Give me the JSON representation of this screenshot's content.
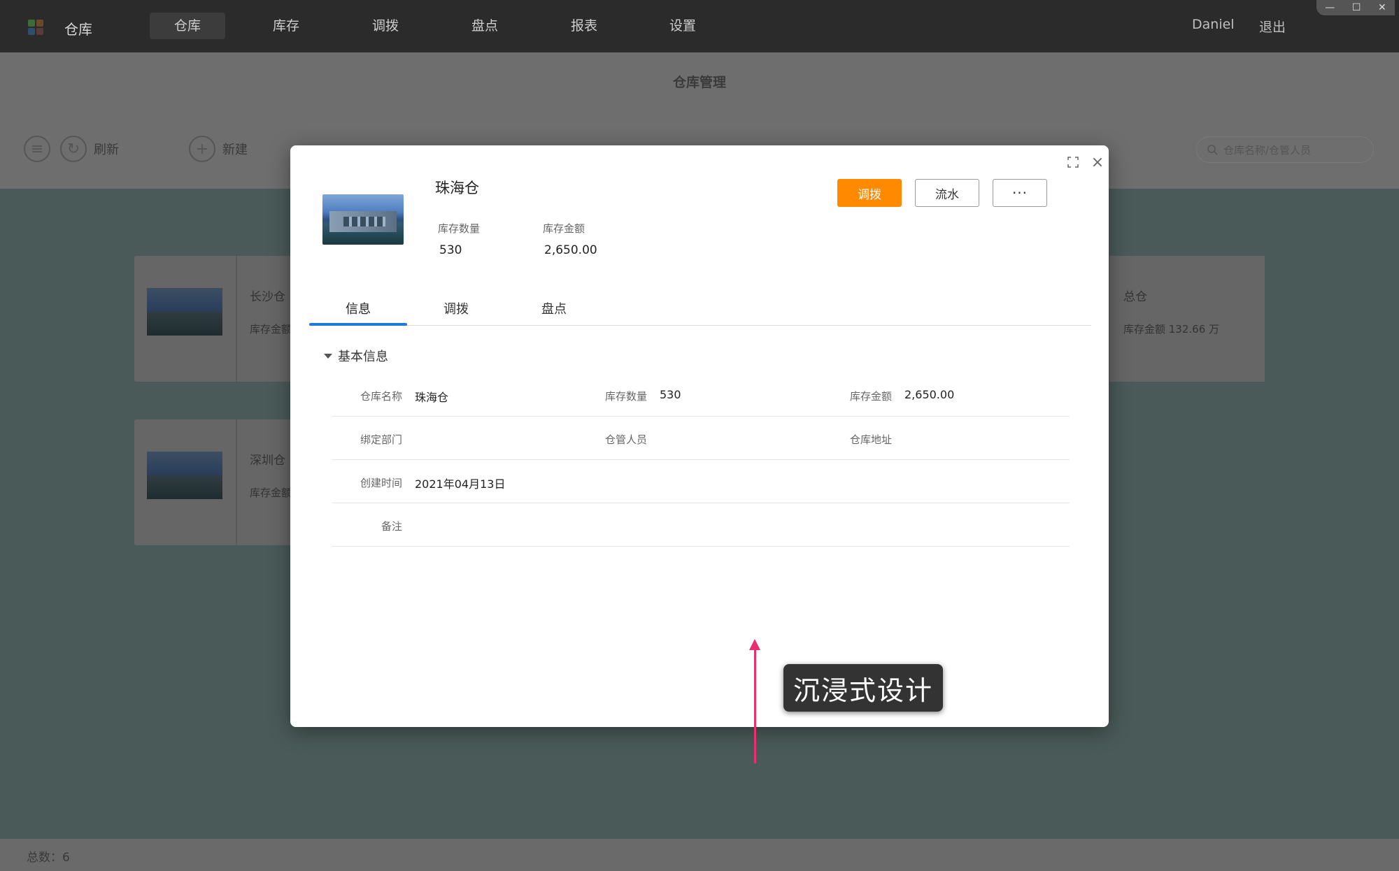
{
  "app": {
    "title": "仓库",
    "user": "Daniel",
    "logout": "退出",
    "window_controls": [
      "—",
      "☐",
      "✕"
    ]
  },
  "nav": {
    "items": [
      {
        "label": "仓库",
        "active": true
      },
      {
        "label": "库存"
      },
      {
        "label": "调拨"
      },
      {
        "label": "盘点"
      },
      {
        "label": "报表"
      },
      {
        "label": "设置"
      }
    ]
  },
  "page": {
    "title": "仓库管理",
    "toolbar": {
      "refresh": "刷新",
      "new": "新建"
    },
    "search_placeholder": "仓库名称/仓管人员"
  },
  "background_cards": [
    {
      "name": "长沙仓",
      "meta": "库存金额"
    },
    {
      "name": "深圳仓",
      "meta": "库存金额"
    }
  ],
  "background_total_card": {
    "name": "总仓",
    "meta": "库存金额 132.66 万"
  },
  "footer": {
    "total": "总数：6"
  },
  "modal": {
    "warehouse_name": "珠海仓",
    "stats": [
      {
        "label": "库存数量",
        "value": "530"
      },
      {
        "label": "库存金额",
        "value": "2,650.00"
      }
    ],
    "buttons": {
      "transfer": "调拨",
      "flow": "流水",
      "more": "···"
    },
    "tabs": [
      {
        "label": "信息",
        "active": true
      },
      {
        "label": "调拨"
      },
      {
        "label": "盘点"
      }
    ],
    "section_title": "基本信息",
    "fields": {
      "name_label": "仓库名称",
      "name_value": "珠海仓",
      "qty_label": "库存数量",
      "qty_value": "530",
      "amount_label": "库存金额",
      "amount_value": "2,650.00",
      "dept_label": "绑定部门",
      "dept_value": "",
      "keeper_label": "仓管人员",
      "keeper_value": "",
      "address_label": "仓库地址",
      "address_value": "",
      "created_label": "创建时间",
      "created_value": "2021年04月13日",
      "note_label": "备注",
      "note_value": ""
    }
  },
  "annotation": {
    "text": "沉浸式设计",
    "color": "#ea2f6e"
  },
  "colors": {
    "primary": "#ff8a00",
    "tab_accent": "#1f7ae0",
    "topbar": "#2b2b2b"
  }
}
